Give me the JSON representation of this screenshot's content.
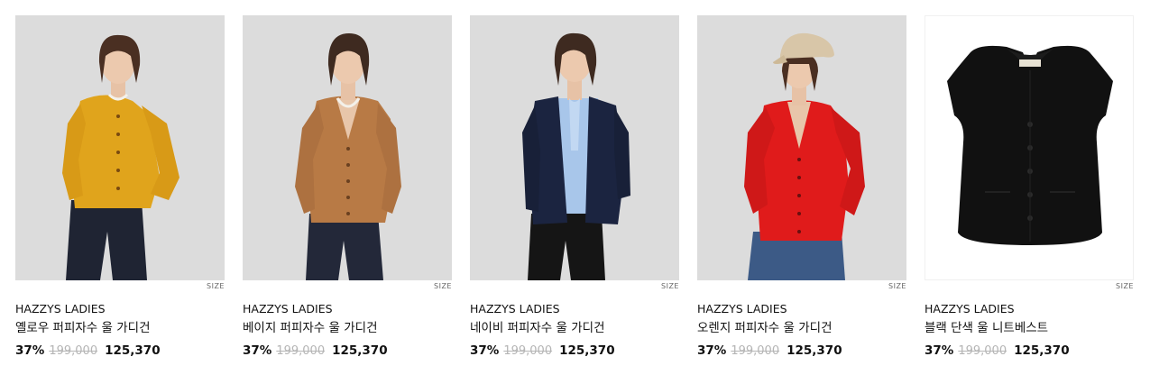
{
  "products": [
    {
      "brand": "HAZZYS LADIES",
      "name": "옐로우 퍼피자수 울 가디건",
      "discount": "37%",
      "original_price": "199,000",
      "sale_price": "125,370",
      "size_label": "SIZE",
      "garment_color": "#e0a41c",
      "image": "model-yellow-cardigan"
    },
    {
      "brand": "HAZZYS LADIES",
      "name": "베이지 퍼피자수 울 가디건",
      "discount": "37%",
      "original_price": "199,000",
      "sale_price": "125,370",
      "size_label": "SIZE",
      "garment_color": "#b87a45",
      "image": "model-beige-cardigan"
    },
    {
      "brand": "HAZZYS LADIES",
      "name": "네이비 퍼피자수 울 가디건",
      "discount": "37%",
      "original_price": "199,000",
      "sale_price": "125,370",
      "size_label": "SIZE",
      "garment_color": "#1b2440",
      "image": "model-navy-cardigan"
    },
    {
      "brand": "HAZZYS LADIES",
      "name": "오렌지 퍼피자수 울 가디건",
      "discount": "37%",
      "original_price": "199,000",
      "sale_price": "125,370",
      "size_label": "SIZE",
      "garment_color": "#e01b1b",
      "image": "model-red-cardigan"
    },
    {
      "brand": "HAZZYS LADIES",
      "name": "블랙 단색 울 니트베스트",
      "discount": "37%",
      "original_price": "199,000",
      "sale_price": "125,370",
      "size_label": "SIZE",
      "garment_color": "#111111",
      "image": "black-knit-vest"
    }
  ]
}
